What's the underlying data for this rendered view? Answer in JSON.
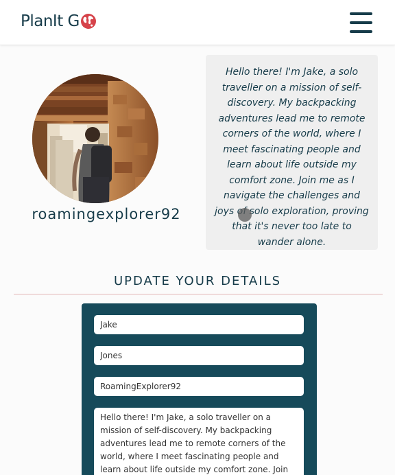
{
  "header": {
    "logo_text": "PlanIt G",
    "logo_icon": "globe-icon",
    "menu_icon": "hamburger-menu-icon"
  },
  "profile": {
    "avatar_alt": "profile photo",
    "username": "roamingexplorer92",
    "bio": "Hello there! I'm Jake, a solo traveller on a mission of self-discovery. My backpacking adventures lead me to remote corners of the world, where I meet fascinating people and learn about life outside my comfort zone. Join me as I navigate the challenges and joys of solo exploration, proving that it's never too late to wander alone."
  },
  "update": {
    "title": "UPDATE YOUR DETAILS",
    "first_name": "Jake",
    "last_name": "Jones",
    "username": "RoamingExplorer92",
    "bio": "Hello there! I'm Jake, a solo traveller on a mission of self-discovery. My backpacking adventures lead me to remote corners of the world, where I meet fascinating people and learn about life outside my comfort zone. Join me as I navigate the challenges"
  },
  "colors": {
    "brand": "#173c4a",
    "panel": "#164a5a",
    "accent_red": "#d6434a",
    "divider": "#e2b4b4"
  }
}
